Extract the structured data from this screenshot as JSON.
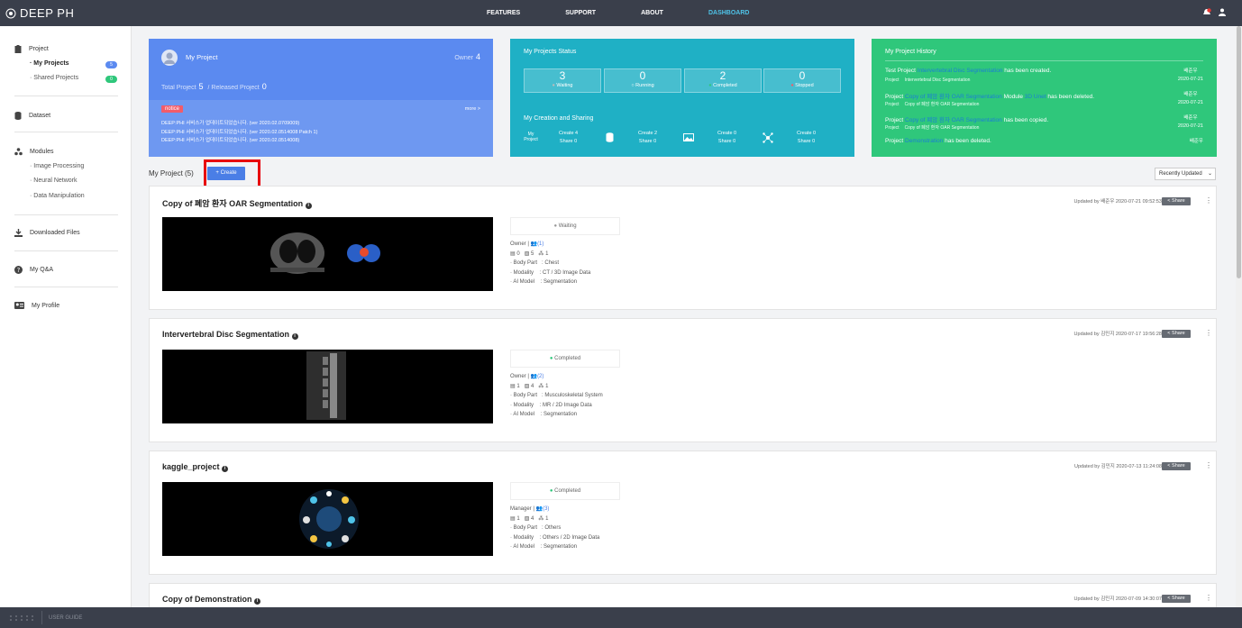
{
  "header": {
    "logo": "DEEP PH",
    "nav": [
      "FEATURES",
      "SUPPORT",
      "ABOUT",
      "DASHBOARD"
    ]
  },
  "sidebar": {
    "project": "Project",
    "my_projects": "· My Projects",
    "my_projects_count": "5",
    "shared_projects": "· Shared Projects",
    "shared_projects_count": "0",
    "dataset": "Dataset",
    "modules": "Modules",
    "image_processing": "· Image Processing",
    "neural_network": "· Neural Network",
    "data_manipulation": "· Data Manipulation",
    "downloaded_files": "Downloaded Files",
    "my_qna": "My Q&A",
    "my_profile": "My Profile"
  },
  "my_project_card": {
    "title": "My Project",
    "owner_label": "Owner",
    "owner_count": "4",
    "total_label": "Total Project",
    "total_count": "5",
    "released_label": "/ Released Project",
    "released_count": "0",
    "notice_badge": "notice",
    "more": "more >",
    "notices": [
      "DEEP:PHI 서비스가 업데이트되었습니다. (ver 2020.02.0709009)",
      "DEEP:PHI 서비스가 업데이트되었습니다. (ver 2020.02.0514008 Patch 1)",
      "DEEP:PHI 서비스가 업데이트되었습니다. (ver 2020.02.0514008)"
    ]
  },
  "status_card": {
    "title": "My Projects Status",
    "stats": [
      {
        "n": "3",
        "label": "Waiting"
      },
      {
        "n": "0",
        "label": "Running"
      },
      {
        "n": "2",
        "label": "Completed"
      },
      {
        "n": "0",
        "label": "Stopped"
      }
    ],
    "sharing_title": "My Creation and Sharing",
    "my_project_label": "My Project",
    "sharing": [
      {
        "create": "Create 4",
        "share": "Share 0"
      },
      {
        "create": "Create 2",
        "share": "Share 0"
      },
      {
        "create": "Create 0",
        "share": "Share 0"
      },
      {
        "create": "Create 0",
        "share": "Share 0"
      }
    ]
  },
  "history_card": {
    "title": "My Project History",
    "items": [
      {
        "pre": "Test Project",
        "link": "Intervertebral Disc Segmentation",
        "post": "has been created.",
        "tag": "Project",
        "sub": "Intervertebral Disc Segmentation",
        "user": "배준우",
        "date": "2020-07-21"
      },
      {
        "pre": "Project",
        "link": "Copy of 폐암 환자 OAR Segmentation",
        "post": "Module",
        "link2": "3D Unet",
        "post2": "has been deleted.",
        "tag": "Project",
        "sub": "Copy of 폐암 환자 OAR Segmentation",
        "user": "배준우",
        "date": "2020-07-21"
      },
      {
        "pre": "Project",
        "link": "Copy of 폐암 환자 OAR Segmentation",
        "post": "has been copied.",
        "tag": "Project",
        "sub": "Copy of 폐암 환자 OAR Segmentation",
        "user": "배준우",
        "date": "2020-07-21"
      },
      {
        "pre": "Project",
        "link": "Demonstration",
        "post": "has been deleted.",
        "user": "배준우"
      }
    ]
  },
  "list_header": {
    "title": "My Project (5)",
    "create": "+ Create",
    "sort": "Recently Updated"
  },
  "projects": [
    {
      "title": "Copy of 폐암 환자 OAR Segmentation",
      "updated": "Updated by 배준우 2020-07-21 09:52:53",
      "share": "Share",
      "status": "Waiting",
      "role": "Owner",
      "members": "(1)",
      "datasets": "0",
      "images": "5",
      "modules": "1",
      "body_part": "Chest",
      "modality": "CT / 3D Image Data",
      "ai_model": "Segmentation"
    },
    {
      "title": "Intervertebral Disc Segmentation",
      "updated": "Updated by 김민지 2020-07-17 19:56:28",
      "share": "Share",
      "status": "Completed",
      "role": "Owner",
      "members": "(2)",
      "datasets": "1",
      "images": "4",
      "modules": "1",
      "body_part": "Musculoskeletal System",
      "modality": "MR / 2D Image Data",
      "ai_model": "Segmentation"
    },
    {
      "title": "kaggle_project",
      "updated": "Updated by 김민지 2020-07-13 11:24:08",
      "share": "Share",
      "status": "Completed",
      "role": "Manager",
      "members": "(3)",
      "datasets": "1",
      "images": "4",
      "modules": "1",
      "body_part": "Others",
      "modality": "Others / 2D Image Data",
      "ai_model": "Segmentation"
    },
    {
      "title": "Copy of Demonstration",
      "updated": "Updated by 김민지 2020-07-09 14:30:07",
      "share": "Share"
    }
  ],
  "labels": {
    "body_part": "Body Part",
    "modality": "Modality",
    "ai_model": "AI Model",
    "colon": ":"
  },
  "footer": {
    "user_guide": "USER GUIDE"
  }
}
